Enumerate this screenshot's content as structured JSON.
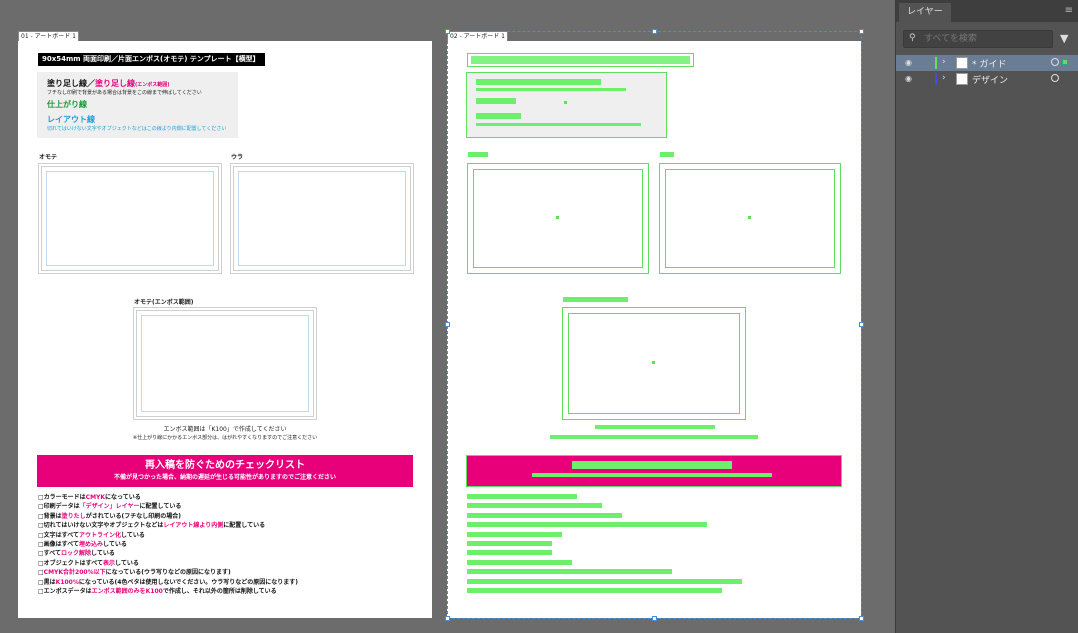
{
  "artboards": [
    {
      "label": "01 - アートボード 1"
    },
    {
      "label": "02 - アートボード 1"
    }
  ],
  "template": {
    "title": "90x54mm 両面印刷／片面エンボス(オモテ) テンプレート【横型】",
    "legend": {
      "bleed_title_a": "塗り足し線／",
      "bleed_title_b": "塗り足し線",
      "bleed_title_c": "(エンボス範囲)",
      "bleed_note": "フチなし印刷で背景がある場合は背景をこの線まで伸ばしてください",
      "trim_title": "仕上がり線",
      "layout_title": "レイアウト線",
      "layout_note": "切れてはいけない文字やオブジェクトなどはこの線より内側に配置してください"
    },
    "front_label": "オモテ",
    "back_label": "ウラ",
    "emboss_label": "オモテ(エンボス範囲)",
    "emboss_note_1": "エンボス範囲は「K100」で作成してください",
    "emboss_note_2": "※仕上がり線にかかるエンボス部分は、はがれやすくなりますのでご注意ください",
    "checklist_title": "再入稿を防ぐためのチェックリスト",
    "checklist_subtitle": "不備が見つかった場合、納期の遅延が生じる可能性がありますのでご注意ください",
    "checklist": [
      {
        "a": "□カラーモードは",
        "b": "CMYK",
        "c": "になっている"
      },
      {
        "a": "□印刷データは",
        "b": "「デザイン」レイヤー",
        "c": "に配置している"
      },
      {
        "a": "□背景は",
        "b": "塗りたし",
        "c": "がされている(フチなし印刷の場合)"
      },
      {
        "a": "□切れてはいけない文字やオブジェクトなどは",
        "b": "レイアウト線より内側",
        "c": "に配置している"
      },
      {
        "a": "□文字はすべて",
        "b": "アウトライン化",
        "c": "している"
      },
      {
        "a": "□画像はすべて",
        "b": "埋め込み",
        "c": "している"
      },
      {
        "a": "□すべて",
        "b": "ロック解除",
        "c": "している"
      },
      {
        "a": "□オブジェクトはすべて",
        "b": "表示",
        "c": "している"
      },
      {
        "a": "□",
        "b": "CMYK合計200%以下",
        "c": "になっている(ウラ写りなどの原因になります)"
      },
      {
        "a": "□黒は",
        "b": "K100%",
        "c": "になっている(4色ベタは使用しないでください。ウラ写りなどの原因になります)"
      },
      {
        "a": "□エンボスデータは",
        "b": "エンボス範囲のみをK100",
        "c": "で作成し、それ以外の箇所は削除している"
      }
    ]
  },
  "layers_panel": {
    "tab_label": "レイヤー",
    "search_placeholder": "すべてを検索",
    "layers": [
      {
        "name": "* ガイド",
        "color": "#5ee05e",
        "selected": true
      },
      {
        "name": "デザイン",
        "color": "#4a4ad8",
        "selected": false
      }
    ]
  },
  "colors": {
    "magenta": "#e8007a",
    "guide_green": "#5ee05e",
    "selection_blue": "#4a8cd8",
    "trim_green": "#1a9a3a",
    "layout_blue": "#1aa0d8"
  }
}
